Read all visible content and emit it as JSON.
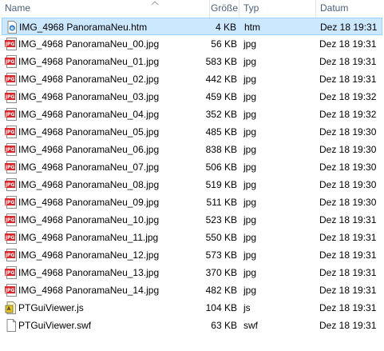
{
  "columns": {
    "name": "Name",
    "size": "Größe",
    "type": "Typ",
    "date": "Datum"
  },
  "files": [
    {
      "name": "IMG_4968 PanoramaNeu.htm",
      "size": "4 KB",
      "type": "htm",
      "date": "Dez 18 19:31",
      "icon": "htm-file-icon",
      "selected": true
    },
    {
      "name": "IMG_4968 PanoramaNeu_00.jpg",
      "size": "56 KB",
      "type": "jpg",
      "date": "Dez 18 19:31",
      "icon": "jpg-file-icon"
    },
    {
      "name": "IMG_4968 PanoramaNeu_01.jpg",
      "size": "583 KB",
      "type": "jpg",
      "date": "Dez 18 19:31",
      "icon": "jpg-file-icon"
    },
    {
      "name": "IMG_4968 PanoramaNeu_02.jpg",
      "size": "442 KB",
      "type": "jpg",
      "date": "Dez 18 19:31",
      "icon": "jpg-file-icon"
    },
    {
      "name": "IMG_4968 PanoramaNeu_03.jpg",
      "size": "459 KB",
      "type": "jpg",
      "date": "Dez 18 19:32",
      "icon": "jpg-file-icon"
    },
    {
      "name": "IMG_4968 PanoramaNeu_04.jpg",
      "size": "352 KB",
      "type": "jpg",
      "date": "Dez 18 19:32",
      "icon": "jpg-file-icon"
    },
    {
      "name": "IMG_4968 PanoramaNeu_05.jpg",
      "size": "485 KB",
      "type": "jpg",
      "date": "Dez 18 19:30",
      "icon": "jpg-file-icon"
    },
    {
      "name": "IMG_4968 PanoramaNeu_06.jpg",
      "size": "838 KB",
      "type": "jpg",
      "date": "Dez 18 19:30",
      "icon": "jpg-file-icon"
    },
    {
      "name": "IMG_4968 PanoramaNeu_07.jpg",
      "size": "506 KB",
      "type": "jpg",
      "date": "Dez 18 19:30",
      "icon": "jpg-file-icon"
    },
    {
      "name": "IMG_4968 PanoramaNeu_08.jpg",
      "size": "519 KB",
      "type": "jpg",
      "date": "Dez 18 19:30",
      "icon": "jpg-file-icon"
    },
    {
      "name": "IMG_4968 PanoramaNeu_09.jpg",
      "size": "511 KB",
      "type": "jpg",
      "date": "Dez 18 19:30",
      "icon": "jpg-file-icon"
    },
    {
      "name": "IMG_4968 PanoramaNeu_10.jpg",
      "size": "523 KB",
      "type": "jpg",
      "date": "Dez 18 19:31",
      "icon": "jpg-file-icon"
    },
    {
      "name": "IMG_4968 PanoramaNeu_11.jpg",
      "size": "550 KB",
      "type": "jpg",
      "date": "Dez 18 19:31",
      "icon": "jpg-file-icon"
    },
    {
      "name": "IMG_4968 PanoramaNeu_12.jpg",
      "size": "573 KB",
      "type": "jpg",
      "date": "Dez 18 19:31",
      "icon": "jpg-file-icon"
    },
    {
      "name": "IMG_4968 PanoramaNeu_13.jpg",
      "size": "370 KB",
      "type": "jpg",
      "date": "Dez 18 19:31",
      "icon": "jpg-file-icon"
    },
    {
      "name": "IMG_4968 PanoramaNeu_14.jpg",
      "size": "482 KB",
      "type": "jpg",
      "date": "Dez 18 19:31",
      "icon": "jpg-file-icon"
    },
    {
      "name": "PTGuiViewer.js",
      "size": "104 KB",
      "type": "js",
      "date": "Dez 18 19:31",
      "icon": "js-file-icon"
    },
    {
      "name": "PTGuiViewer.swf",
      "size": "63 KB",
      "type": "swf",
      "date": "Dez 18 19:31",
      "icon": "swf-file-icon"
    }
  ],
  "colors": {
    "header_text": "#4c607a",
    "selected_bg": "#cce8ff",
    "selected_border": "#99d1ff",
    "jpg_icon_red": "#d8262a"
  }
}
